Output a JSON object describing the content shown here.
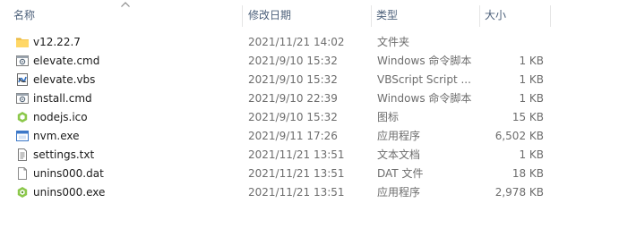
{
  "columns": {
    "name": "名称",
    "date": "修改日期",
    "type": "类型",
    "size": "大小"
  },
  "files": [
    {
      "name": "v12.22.7",
      "date": "2021/11/21 14:02",
      "type": "文件夹",
      "size": "",
      "icon": "folder-icon"
    },
    {
      "name": "elevate.cmd",
      "date": "2021/9/10 15:32",
      "type": "Windows 命令脚本",
      "size": "1 KB",
      "icon": "cmd-script-icon"
    },
    {
      "name": "elevate.vbs",
      "date": "2021/9/10 15:32",
      "type": "VBScript Script ...",
      "size": "1 KB",
      "icon": "vbscript-icon"
    },
    {
      "name": "install.cmd",
      "date": "2021/9/10 22:39",
      "type": "Windows 命令脚本",
      "size": "1 KB",
      "icon": "cmd-script-icon"
    },
    {
      "name": "nodejs.ico",
      "date": "2021/9/10 15:32",
      "type": "图标",
      "size": "15 KB",
      "icon": "nodejs-icon"
    },
    {
      "name": "nvm.exe",
      "date": "2021/9/11 17:26",
      "type": "应用程序",
      "size": "6,502 KB",
      "icon": "application-icon"
    },
    {
      "name": "settings.txt",
      "date": "2021/11/21 13:51",
      "type": "文本文档",
      "size": "1 KB",
      "icon": "text-document-icon"
    },
    {
      "name": "unins000.dat",
      "date": "2021/11/21 13:51",
      "type": "DAT 文件",
      "size": "18 KB",
      "icon": "generic-file-icon"
    },
    {
      "name": "unins000.exe",
      "date": "2021/11/21 13:51",
      "type": "应用程序",
      "size": "2,978 KB",
      "icon": "uninstaller-icon"
    }
  ],
  "colors": {
    "header_text": "#4c607a",
    "folder": "#ffd766",
    "accent": "#3c78c8",
    "node_green": "#8cc84b"
  }
}
